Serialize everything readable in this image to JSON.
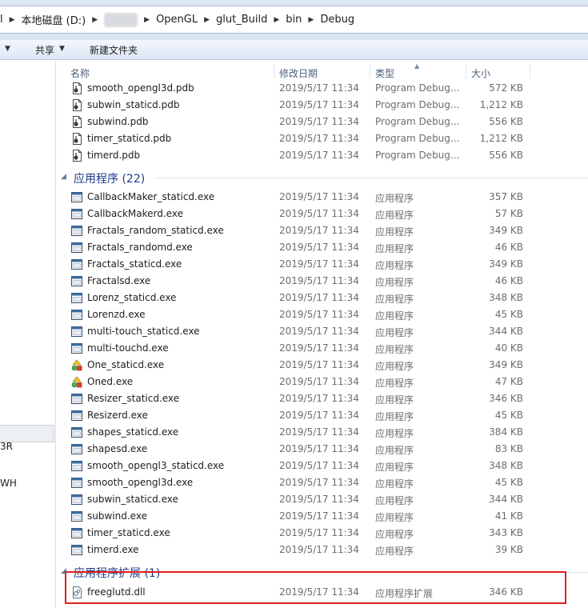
{
  "address_bar": {
    "crumbs": [
      "本地磁盘 (D:)",
      "OpenGL",
      "glut_Build",
      "bin",
      "Debug"
    ],
    "leading_fragment": "l"
  },
  "toolbar": {
    "share_label": "共享",
    "new_folder_label": "新建文件夹"
  },
  "nav_pane": {
    "fragments": [
      "3R",
      "WH"
    ]
  },
  "columns": {
    "name": "名称",
    "date": "修改日期",
    "type": "类型",
    "size": "大小"
  },
  "pdb_rows": [
    {
      "name": "smooth_opengl3d.pdb",
      "date": "2019/5/17 11:34",
      "type": "Program Debug...",
      "size": "572 KB"
    },
    {
      "name": "subwin_staticd.pdb",
      "date": "2019/5/17 11:34",
      "type": "Program Debug...",
      "size": "1,212 KB"
    },
    {
      "name": "subwind.pdb",
      "date": "2019/5/17 11:34",
      "type": "Program Debug...",
      "size": "556 KB"
    },
    {
      "name": "timer_staticd.pdb",
      "date": "2019/5/17 11:34",
      "type": "Program Debug...",
      "size": "1,212 KB"
    },
    {
      "name": "timerd.pdb",
      "date": "2019/5/17 11:34",
      "type": "Program Debug...",
      "size": "556 KB"
    }
  ],
  "groups": {
    "apps": "应用程序 (22)",
    "ext": "应用程序扩展 (1)"
  },
  "exe_rows": [
    {
      "name": "CallbackMaker_staticd.exe",
      "date": "2019/5/17 11:34",
      "type": "应用程序",
      "size": "357 KB",
      "icon": "exe"
    },
    {
      "name": "CallbackMakerd.exe",
      "date": "2019/5/17 11:34",
      "type": "应用程序",
      "size": "57 KB",
      "icon": "exe"
    },
    {
      "name": "Fractals_random_staticd.exe",
      "date": "2019/5/17 11:34",
      "type": "应用程序",
      "size": "349 KB",
      "icon": "exe"
    },
    {
      "name": "Fractals_randomd.exe",
      "date": "2019/5/17 11:34",
      "type": "应用程序",
      "size": "46 KB",
      "icon": "exe"
    },
    {
      "name": "Fractals_staticd.exe",
      "date": "2019/5/17 11:34",
      "type": "应用程序",
      "size": "349 KB",
      "icon": "exe"
    },
    {
      "name": "Fractalsd.exe",
      "date": "2019/5/17 11:34",
      "type": "应用程序",
      "size": "46 KB",
      "icon": "exe"
    },
    {
      "name": "Lorenz_staticd.exe",
      "date": "2019/5/17 11:34",
      "type": "应用程序",
      "size": "348 KB",
      "icon": "exe"
    },
    {
      "name": "Lorenzd.exe",
      "date": "2019/5/17 11:34",
      "type": "应用程序",
      "size": "45 KB",
      "icon": "exe"
    },
    {
      "name": "multi-touch_staticd.exe",
      "date": "2019/5/17 11:34",
      "type": "应用程序",
      "size": "344 KB",
      "icon": "exe"
    },
    {
      "name": "multi-touchd.exe",
      "date": "2019/5/17 11:34",
      "type": "应用程序",
      "size": "40 KB",
      "icon": "exe"
    },
    {
      "name": "One_staticd.exe",
      "date": "2019/5/17 11:34",
      "type": "应用程序",
      "size": "349 KB",
      "icon": "shapes"
    },
    {
      "name": "Oned.exe",
      "date": "2019/5/17 11:34",
      "type": "应用程序",
      "size": "47 KB",
      "icon": "shapes"
    },
    {
      "name": "Resizer_staticd.exe",
      "date": "2019/5/17 11:34",
      "type": "应用程序",
      "size": "346 KB",
      "icon": "exe"
    },
    {
      "name": "Resizerd.exe",
      "date": "2019/5/17 11:34",
      "type": "应用程序",
      "size": "45 KB",
      "icon": "exe"
    },
    {
      "name": "shapes_staticd.exe",
      "date": "2019/5/17 11:34",
      "type": "应用程序",
      "size": "384 KB",
      "icon": "exe"
    },
    {
      "name": "shapesd.exe",
      "date": "2019/5/17 11:34",
      "type": "应用程序",
      "size": "83 KB",
      "icon": "exe"
    },
    {
      "name": "smooth_opengl3_staticd.exe",
      "date": "2019/5/17 11:34",
      "type": "应用程序",
      "size": "348 KB",
      "icon": "exe"
    },
    {
      "name": "smooth_opengl3d.exe",
      "date": "2019/5/17 11:34",
      "type": "应用程序",
      "size": "45 KB",
      "icon": "exe"
    },
    {
      "name": "subwin_staticd.exe",
      "date": "2019/5/17 11:34",
      "type": "应用程序",
      "size": "344 KB",
      "icon": "exe"
    },
    {
      "name": "subwind.exe",
      "date": "2019/5/17 11:34",
      "type": "应用程序",
      "size": "41 KB",
      "icon": "exe"
    },
    {
      "name": "timer_staticd.exe",
      "date": "2019/5/17 11:34",
      "type": "应用程序",
      "size": "343 KB",
      "icon": "exe"
    },
    {
      "name": "timerd.exe",
      "date": "2019/5/17 11:34",
      "type": "应用程序",
      "size": "39 KB",
      "icon": "exe"
    }
  ],
  "dll_rows": [
    {
      "name": "freeglutd.dll",
      "date": "2019/5/17 11:34",
      "type": "应用程序扩展",
      "size": "346 KB",
      "icon": "dll"
    }
  ],
  "colors": {
    "highlight_border": "#e02020",
    "group_text": "#1e3a8a"
  }
}
